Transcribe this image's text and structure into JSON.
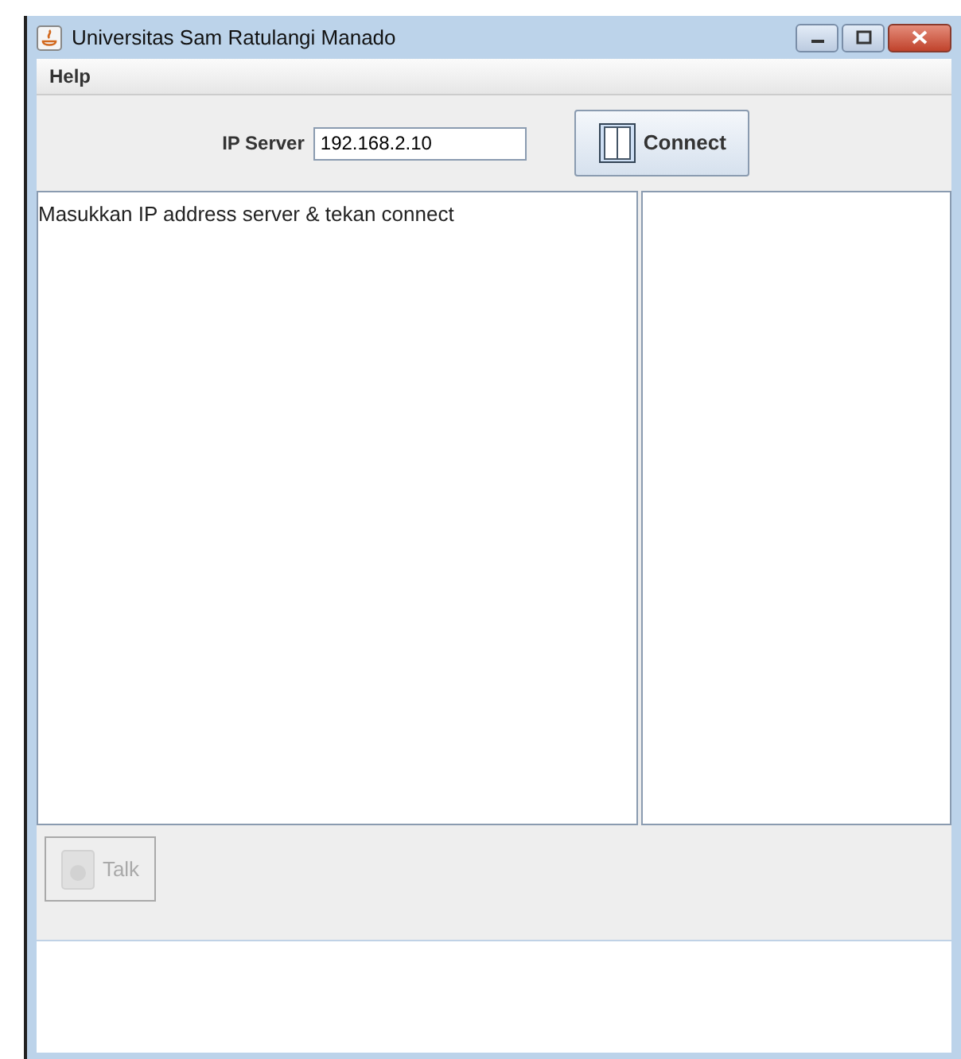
{
  "window": {
    "title": "Universitas Sam Ratulangi Manado"
  },
  "menu": [
    {
      "label": "Help"
    }
  ],
  "toolbar": {
    "ip_label": "IP Server",
    "ip_value": "192.168.2.10",
    "connect_button": {
      "label": "Connect",
      "disabled": false
    }
  },
  "log_text": "Masukkan IP address server & tekan connect",
  "talk_button": {
    "label": "Talk",
    "disabled": true
  }
}
